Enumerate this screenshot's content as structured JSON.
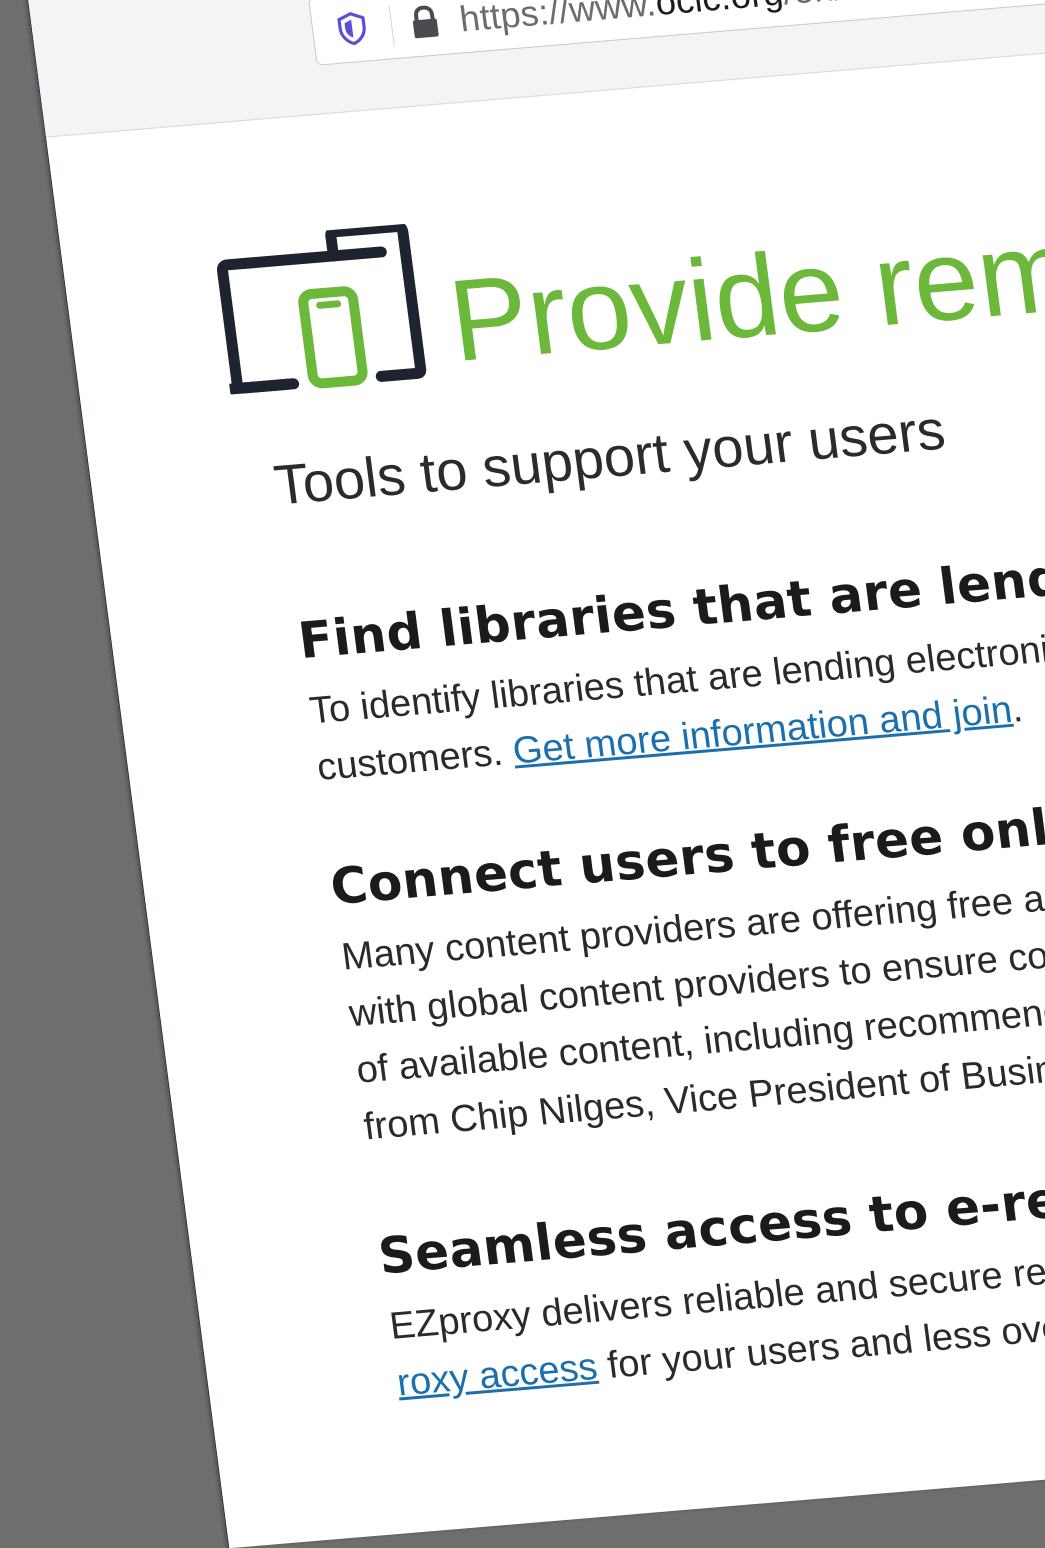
{
  "browser": {
    "url_prefix": "https://www.",
    "url_domain": "oclc.org",
    "url_path": "/en/covid",
    "shield_icon": "shield-icon",
    "lock_icon": "lock-icon"
  },
  "page": {
    "hero_icon": "devices-icon",
    "title": "Provide rem",
    "subtitle": "Tools to support your users"
  },
  "sections": [
    {
      "heading": "Find libraries that are lending e-",
      "line1": "To identify libraries that are lending electroni",
      "line2_prefix": "customers. ",
      "line2_link": "Get more information and join",
      "line2_suffix": "."
    },
    {
      "heading": "Connect users to free online re",
      "lines": [
        "Many content providers are offering free ac",
        "with global content providers to ensure co",
        "of available content, including recommenc",
        "from Chip Nilges, Vice President of Busin"
      ]
    },
    {
      "heading": "Seamless access to e-resourc",
      "line1": "EZproxy delivers reliable and secure rer",
      "line2_link": "roxy access",
      "line2_suffix": " for your users and less ove"
    }
  ],
  "colors": {
    "title_green": "#6cb83a",
    "link_blue": "#1c6fae",
    "shield_purple": "#5b4fd6"
  }
}
